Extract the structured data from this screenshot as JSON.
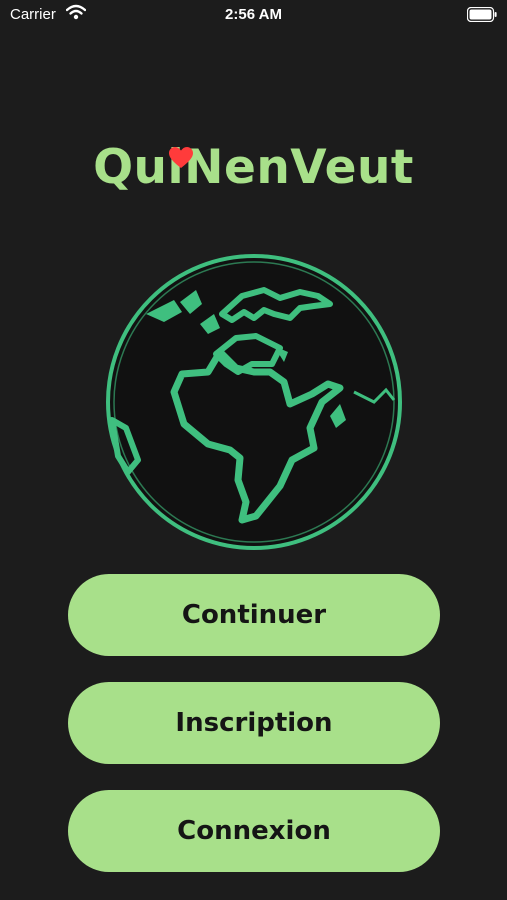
{
  "status_bar": {
    "carrier": "Carrier",
    "time": "2:56 AM",
    "wifi_icon": "wifi-icon",
    "battery_icon": "battery-icon"
  },
  "brand": {
    "name": "QuiNenVeut",
    "heart_icon": "heart-icon",
    "heart_color": "#ff3b3b"
  },
  "illustration": {
    "icon": "globe-icon",
    "stroke_color": "#3fbf7f"
  },
  "buttons": {
    "continue_label": "Continuer",
    "signup_label": "Inscription",
    "login_label": "Connexion"
  },
  "colors": {
    "background": "#1c1c1c",
    "accent": "#a8e08a"
  }
}
